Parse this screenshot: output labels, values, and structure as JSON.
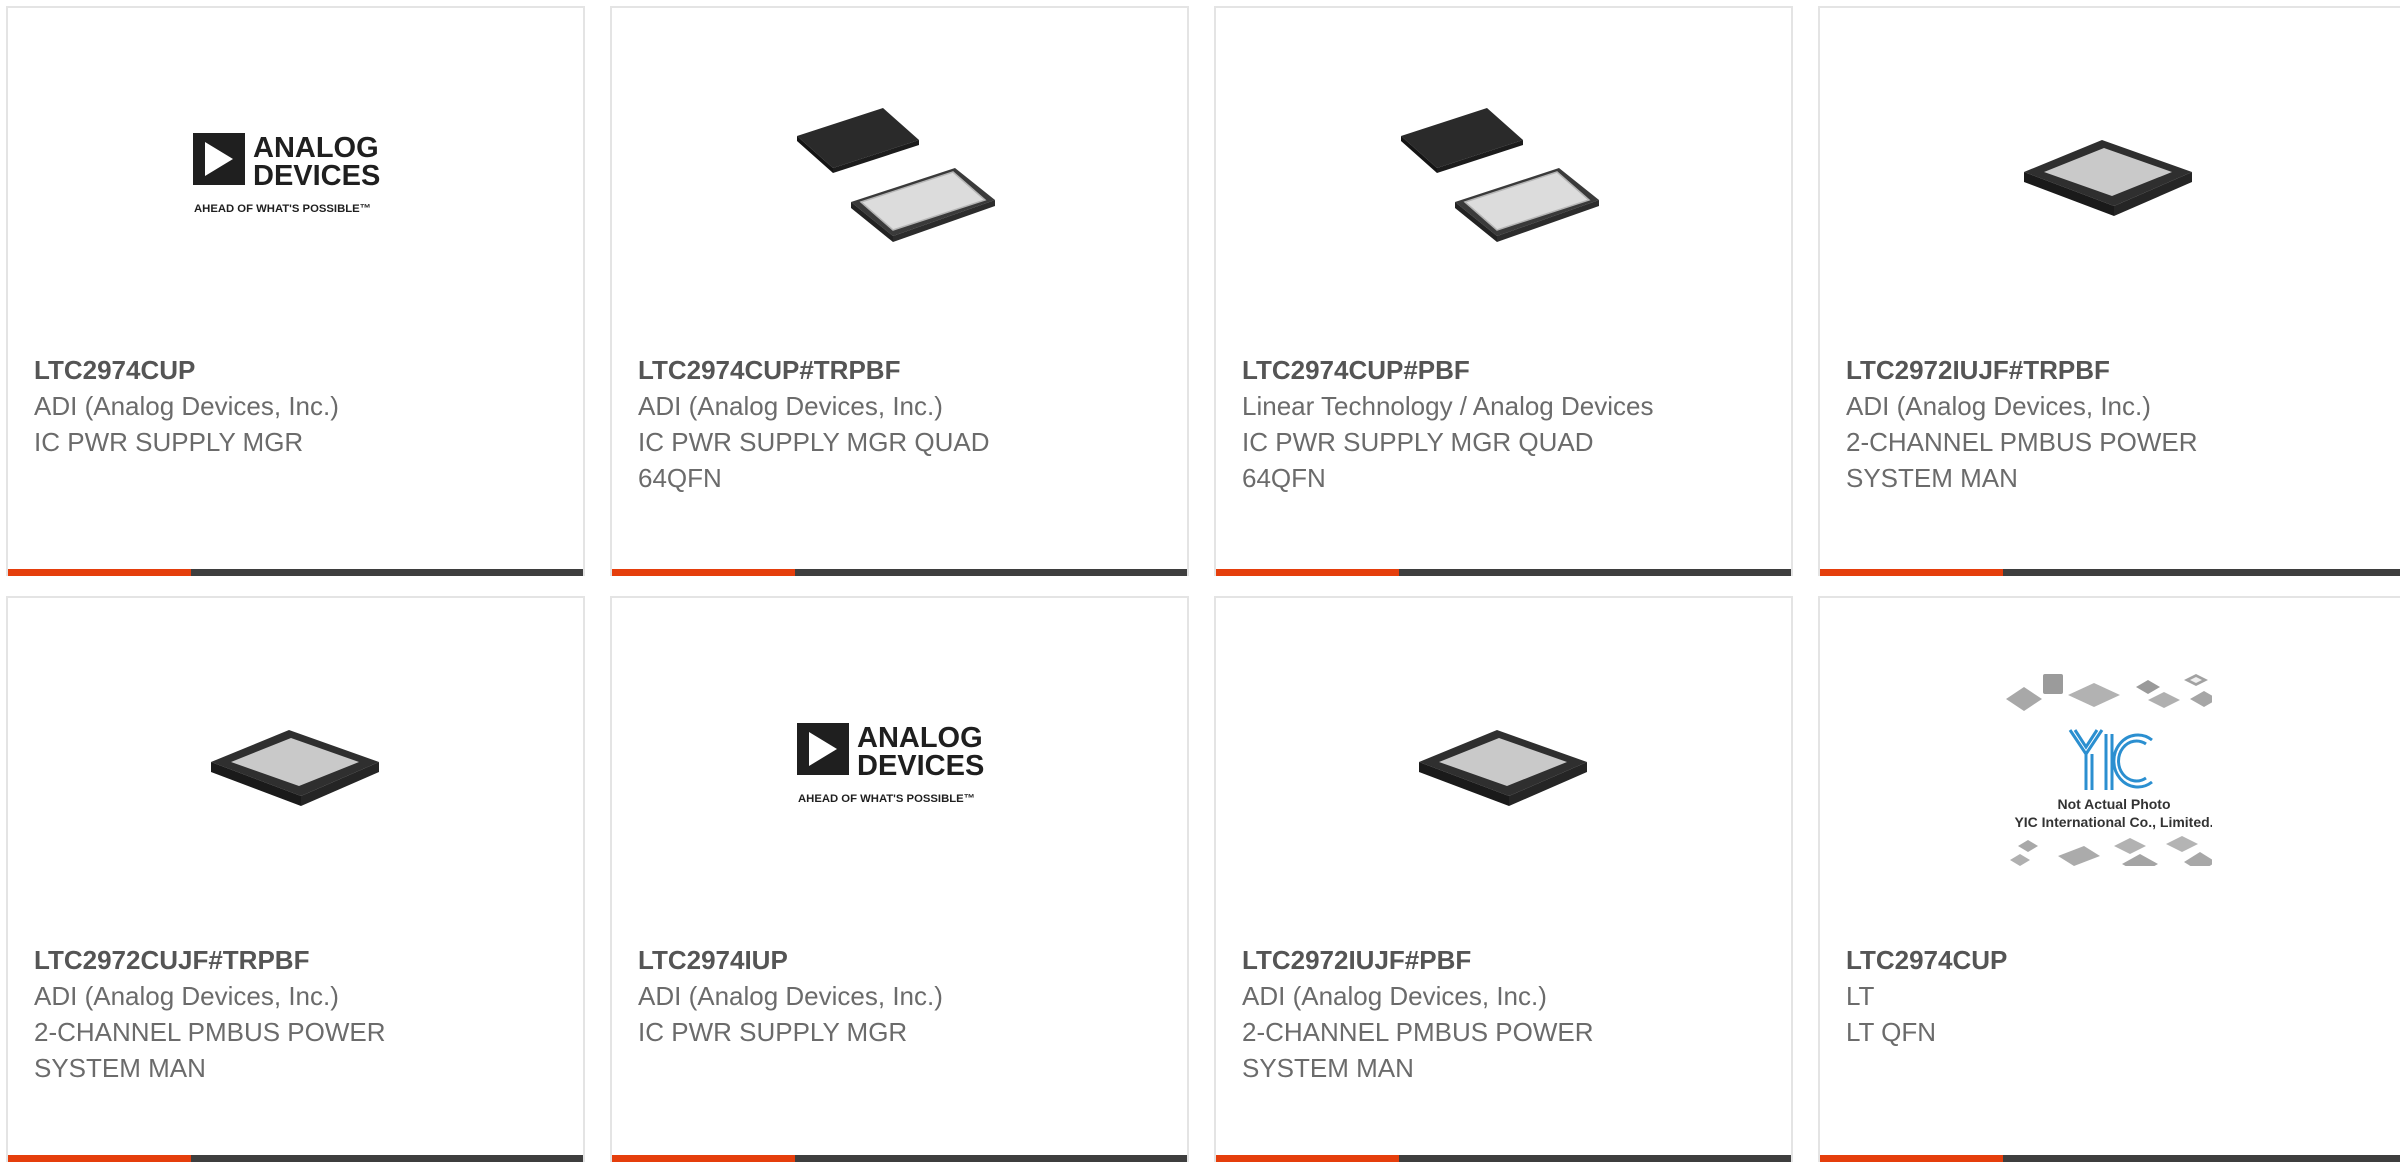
{
  "products": [
    {
      "part": "LTC2974CUP",
      "manufacturer": "ADI (Analog Devices, Inc.)",
      "description": "IC PWR SUPPLY MGR",
      "image": "analog-devices-logo"
    },
    {
      "part": "LTC2974CUP#TRPBF",
      "manufacturer": "ADI (Analog Devices, Inc.)",
      "description": "IC PWR SUPPLY MGR QUAD 64QFN",
      "image": "qfn-chip-pair"
    },
    {
      "part": "LTC2974CUP#PBF",
      "manufacturer": "Linear Technology / Analog Devices",
      "description": "IC PWR SUPPLY MGR QUAD 64QFN",
      "image": "qfn-chip-pair"
    },
    {
      "part": "LTC2972IUJF#TRPBF",
      "manufacturer": "ADI (Analog Devices, Inc.)",
      "description": "2-CHANNEL PMBUS POWER SYSTEM MAN",
      "image": "qfn-chip"
    },
    {
      "part": "LTC2972CUJF#TRPBF",
      "manufacturer": "ADI (Analog Devices, Inc.)",
      "description": "2-CHANNEL PMBUS POWER SYSTEM MAN",
      "image": "qfn-chip"
    },
    {
      "part": "LTC2974IUP",
      "manufacturer": "ADI (Analog Devices, Inc.)",
      "description": "IC PWR SUPPLY MGR",
      "image": "analog-devices-logo"
    },
    {
      "part": "LTC2972IUJF#PBF",
      "manufacturer": "ADI (Analog Devices, Inc.)",
      "description": "2-CHANNEL PMBUS POWER SYSTEM MAN",
      "image": "qfn-chip"
    },
    {
      "part": "LTC2974CUP",
      "manufacturer": "LT",
      "description": "LT QFN",
      "image": "not-actual-photo"
    }
  ],
  "logo": {
    "line1": "ANALOG",
    "line2": "DEVICES",
    "tagline": "AHEAD OF WHAT'S POSSIBLE™"
  },
  "placeholder": {
    "brand": "YIC",
    "line1": "Not Actual Photo",
    "line2": "YIC International Co., Limited."
  },
  "colors": {
    "accent": "#e53e0c",
    "bar": "#3e3e3e",
    "part_text": "#555555",
    "body_text": "#6b6b6b",
    "border": "#e4e4e4"
  }
}
